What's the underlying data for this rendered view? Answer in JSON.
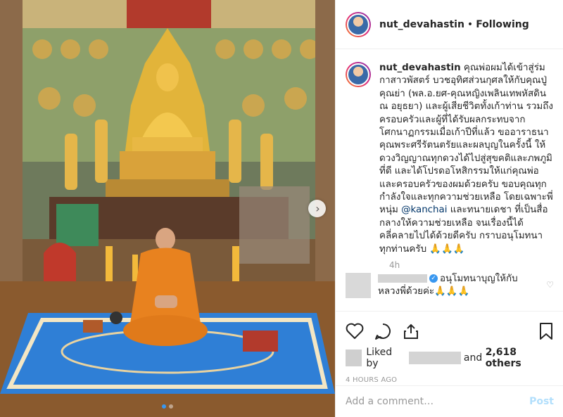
{
  "post": {
    "image_alt": "Monk seated in a Thai temple hall in front of a golden Buddha statue",
    "carousel": {
      "count": 2,
      "active_index": 0
    }
  },
  "header": {
    "username": "nut_devahastin",
    "separator": "•",
    "follow_status": "Following"
  },
  "caption": {
    "username": "nut_devahastin",
    "text_part1": " คุณพ่อผมได้เข้าสู่ร่มกาสาวพัสตร์ บวชอุทิศส่วนกุศลให้กับคุณปู่คุณย่า (พล.อ.ยศ-คุณหญิงเพลินเทพหัสดิน ณ อยุธยา) และผู้เสียชีวิตทั้งเก้าท่าน รวมถึงครอบครัวและผู้ที่ได้รับผลกระทบจากโศกนาฏกรรมเมื่อเก้าปีที่แล้ว ขออาราธนาคุณพระศรีรัตนตรัยและผลบุญในครั้งนี้ ให้ดวงวิญญาณทุกดวงได้ไปสู่สุขคติและภพภูมิที่ดี และได้โปรดอโหสิกรรมให้แก่คุณพ่อ และครอบครัวของผมด้วยครับ ขอบคุณทุกกำลังใจและทุกความช่วยเหลือ โดยเฉพาะพี่หนุ่ม ",
    "mention": "@kanchai",
    "text_part2": " และทนายเดชา ที่เป็นสื่อกลางให้ความช่วยเหลือ จนเรื่องนี้ได้คลี่คลายไปได้ด้วยดีครับ กราบอนุโมทนาทุกท่านครับ 🙏🙏🙏",
    "time_ago": "4h"
  },
  "comment": {
    "text": "อนุโมทนาบุญให้กับหลวงพี่ด้วยค่ะ🙏🙏🙏"
  },
  "actions": {
    "liked_prefix": "Liked by",
    "liked_and": "and",
    "likes_count": "2,618 others",
    "posted_time": "4 HOURS AGO"
  },
  "add_comment": {
    "placeholder": "Add a comment…",
    "post_label": "Post"
  },
  "colors": {
    "accent_blue": "#3897f0",
    "mention": "#003569",
    "muted": "#999999",
    "post_disabled": "#b2dffc"
  }
}
